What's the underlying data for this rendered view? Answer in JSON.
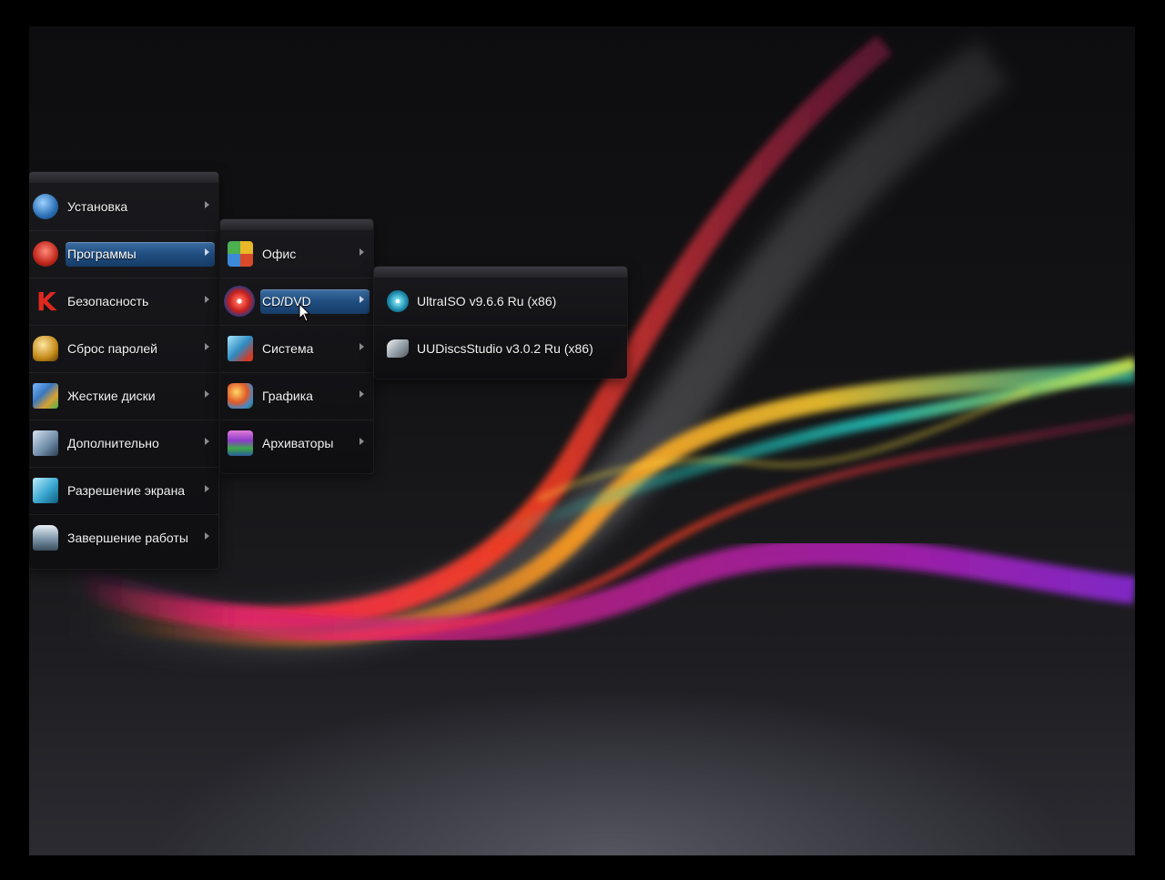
{
  "main_menu": {
    "items": [
      {
        "label": "Установка",
        "icon": "windows-installer-icon"
      },
      {
        "label": "Программы",
        "icon": "programs-icon",
        "active": true
      },
      {
        "label": "Безопасность",
        "icon": "kaspersky-icon"
      },
      {
        "label": "Сброс паролей",
        "icon": "password-reset-icon"
      },
      {
        "label": "Жесткие диски",
        "icon": "hard-disks-icon"
      },
      {
        "label": "Дополнительно",
        "icon": "extra-tools-icon"
      },
      {
        "label": "Разрешение экрана",
        "icon": "screen-resolution-icon"
      },
      {
        "label": "Завершение работы",
        "icon": "shutdown-icon"
      }
    ]
  },
  "programs_menu": {
    "items": [
      {
        "label": "Офис",
        "icon": "office-icon"
      },
      {
        "label": "CD/DVD",
        "icon": "cd-dvd-icon",
        "active": true
      },
      {
        "label": "Система",
        "icon": "system-icon"
      },
      {
        "label": "Графика",
        "icon": "graphics-icon"
      },
      {
        "label": "Архиваторы",
        "icon": "archivers-icon"
      }
    ]
  },
  "cddvd_menu": {
    "items": [
      {
        "label": "UltraISO v9.6.6 Ru (x86)",
        "icon": "ultraiso-disc-icon"
      },
      {
        "label": "UUDiscsStudio v3.0.2 Ru (x86)",
        "icon": "uudiscsstudio-icon"
      }
    ]
  },
  "colors": {
    "highlight": "#2a5a8f",
    "menu_bg": "#16161a",
    "text": "#f2f2f2"
  }
}
